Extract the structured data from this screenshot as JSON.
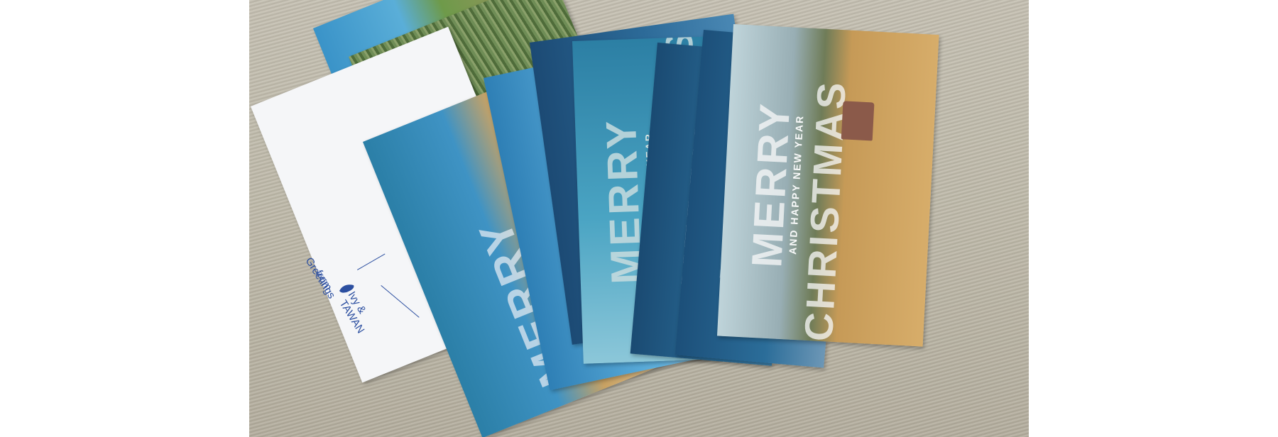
{
  "scene": {
    "background_colors": {
      "table_fabric": "#bdb8a8",
      "page": "#ffffff",
      "sky_blue": "#3f93c4",
      "deep_blue": "#1f4f78",
      "sand": "#c9a263",
      "ink": "#2c4fa0"
    },
    "postcard_back": {
      "greeting_line1": "Greetings",
      "greeting_line2": "from",
      "sender": "Ivy &",
      "place": "TAWAN",
      "icon": "taiwan-map-icon"
    },
    "card_text": {
      "merry": "MERRY",
      "christmas": "CHRISTMAS",
      "new_year": "AND HAPPY NEW YEAR"
    }
  }
}
